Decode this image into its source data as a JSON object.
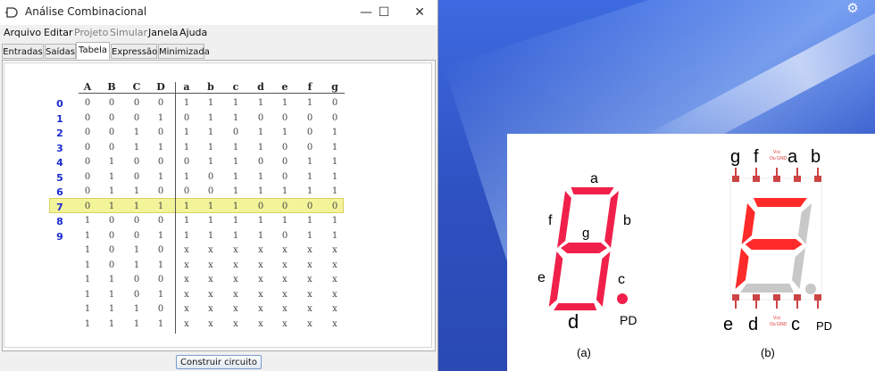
{
  "window": {
    "title": "Análise Combinacional",
    "controls": {
      "minimize": "—",
      "maximize": "☐",
      "close": "✕"
    }
  },
  "menu": [
    {
      "label": "Arquivo",
      "enabled": true
    },
    {
      "label": "Editar",
      "enabled": true
    },
    {
      "label": "Projeto",
      "enabled": false
    },
    {
      "label": "Simular",
      "enabled": false
    },
    {
      "label": "Janela",
      "enabled": true
    },
    {
      "label": "Ajuda",
      "enabled": true
    }
  ],
  "tabs": [
    "Entradas",
    "Saídas",
    "Tabela",
    "Expressão",
    "Minimizada"
  ],
  "active_tab": "Tabela",
  "truth_table": {
    "inputs": [
      "A",
      "B",
      "C",
      "D"
    ],
    "outputs": [
      "a",
      "b",
      "c",
      "d",
      "e",
      "f",
      "g"
    ],
    "row_labels": [
      "0",
      "1",
      "2",
      "3",
      "4",
      "5",
      "6",
      "7",
      "8",
      "9"
    ],
    "highlighted_row": 7,
    "rows": [
      {
        "in": [
          "0",
          "0",
          "0",
          "0"
        ],
        "out": [
          "1",
          "1",
          "1",
          "1",
          "1",
          "1",
          "0"
        ]
      },
      {
        "in": [
          "0",
          "0",
          "0",
          "1"
        ],
        "out": [
          "0",
          "1",
          "1",
          "0",
          "0",
          "0",
          "0"
        ]
      },
      {
        "in": [
          "0",
          "0",
          "1",
          "0"
        ],
        "out": [
          "1",
          "1",
          "0",
          "1",
          "1",
          "0",
          "1"
        ]
      },
      {
        "in": [
          "0",
          "0",
          "1",
          "1"
        ],
        "out": [
          "1",
          "1",
          "1",
          "1",
          "0",
          "0",
          "1"
        ]
      },
      {
        "in": [
          "0",
          "1",
          "0",
          "0"
        ],
        "out": [
          "0",
          "1",
          "1",
          "0",
          "0",
          "1",
          "1"
        ]
      },
      {
        "in": [
          "0",
          "1",
          "0",
          "1"
        ],
        "out": [
          "1",
          "0",
          "1",
          "1",
          "0",
          "1",
          "1"
        ]
      },
      {
        "in": [
          "0",
          "1",
          "1",
          "0"
        ],
        "out": [
          "0",
          "0",
          "1",
          "1",
          "1",
          "1",
          "1"
        ]
      },
      {
        "in": [
          "0",
          "1",
          "1",
          "1"
        ],
        "out": [
          "1",
          "1",
          "1",
          "0",
          "0",
          "0",
          "0"
        ]
      },
      {
        "in": [
          "1",
          "0",
          "0",
          "0"
        ],
        "out": [
          "1",
          "1",
          "1",
          "1",
          "1",
          "1",
          "1"
        ]
      },
      {
        "in": [
          "1",
          "0",
          "0",
          "1"
        ],
        "out": [
          "1",
          "1",
          "1",
          "1",
          "0",
          "1",
          "1"
        ]
      },
      {
        "in": [
          "1",
          "0",
          "1",
          "0"
        ],
        "out": [
          "x",
          "x",
          "x",
          "x",
          "x",
          "x",
          "x"
        ]
      },
      {
        "in": [
          "1",
          "0",
          "1",
          "1"
        ],
        "out": [
          "x",
          "x",
          "x",
          "x",
          "x",
          "x",
          "x"
        ]
      },
      {
        "in": [
          "1",
          "1",
          "0",
          "0"
        ],
        "out": [
          "x",
          "x",
          "x",
          "x",
          "x",
          "x",
          "x"
        ]
      },
      {
        "in": [
          "1",
          "1",
          "0",
          "1"
        ],
        "out": [
          "x",
          "x",
          "x",
          "x",
          "x",
          "x",
          "x"
        ]
      },
      {
        "in": [
          "1",
          "1",
          "1",
          "0"
        ],
        "out": [
          "x",
          "x",
          "x",
          "x",
          "x",
          "x",
          "x"
        ]
      },
      {
        "in": [
          "1",
          "1",
          "1",
          "1"
        ],
        "out": [
          "x",
          "x",
          "x",
          "x",
          "x",
          "x",
          "x"
        ]
      }
    ]
  },
  "build_button": "Construir circuito",
  "figure": {
    "a_labels": {
      "a": "a",
      "b": "b",
      "c": "c",
      "d": "d",
      "e": "e",
      "f": "f",
      "g": "g",
      "pd": "PD"
    },
    "b_top_labels": [
      "g",
      "f",
      "a",
      "b"
    ],
    "b_bottom_labels": [
      "e",
      "d",
      "c",
      "PD"
    ],
    "b_pin_note_top": [
      "Vcc",
      "Ou GND"
    ],
    "b_pin_note_bottom": [
      "Vcc",
      "Ou GND"
    ],
    "caption_a": "(a)",
    "caption_b": "(b)"
  },
  "colors": {
    "segment_on": "#f0204a",
    "segment_on_b": "#ff2a2a",
    "segment_off": "#c8c8c8",
    "row_index": "#1a2ad0",
    "highlight": "#f3f39a"
  },
  "icons": {
    "settings": "gear-icon",
    "app": "logisim-icon"
  }
}
